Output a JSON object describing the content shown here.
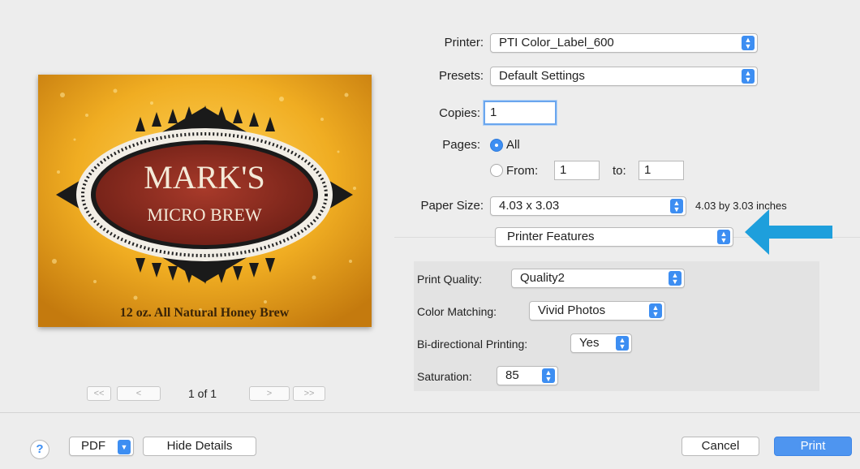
{
  "preview": {
    "label_line1": "MARK'S",
    "label_line2": "MICRO BREW",
    "label_tagline": "12 oz. All Natural Honey Brew",
    "page_counter": "1 of 1",
    "nav_first": "<<",
    "nav_prev": "<",
    "nav_next": ">",
    "nav_last": ">>"
  },
  "printer": {
    "label": "Printer:",
    "value": "PTI Color_Label_600"
  },
  "presets": {
    "label": "Presets:",
    "value": "Default Settings"
  },
  "copies": {
    "label": "Copies:",
    "value": "1"
  },
  "pages": {
    "label": "Pages:",
    "all_label": "All",
    "from_label": "From:",
    "from_value": "1",
    "to_label": "to:",
    "to_value": "1"
  },
  "paper_size": {
    "label": "Paper Size:",
    "value": "4.03 x 3.03",
    "description": "4.03 by 3.03 inches"
  },
  "section": {
    "value": "Printer Features"
  },
  "features": {
    "print_quality": {
      "label": "Print Quality:",
      "value": "Quality2"
    },
    "color_matching": {
      "label": "Color Matching:",
      "value": "Vivid Photos"
    },
    "bidirectional": {
      "label": "Bi-directional Printing:",
      "value": "Yes"
    },
    "saturation": {
      "label": "Saturation:",
      "value": "85"
    }
  },
  "bottom": {
    "help": "?",
    "pdf": "PDF",
    "hide_details": "Hide Details",
    "cancel": "Cancel",
    "print": "Print"
  },
  "colors": {
    "accent": "#3d8ef2",
    "callout_arrow": "#1e9fdc",
    "label_red": "#8a2a1f",
    "label_gold": "#e8a51c"
  }
}
